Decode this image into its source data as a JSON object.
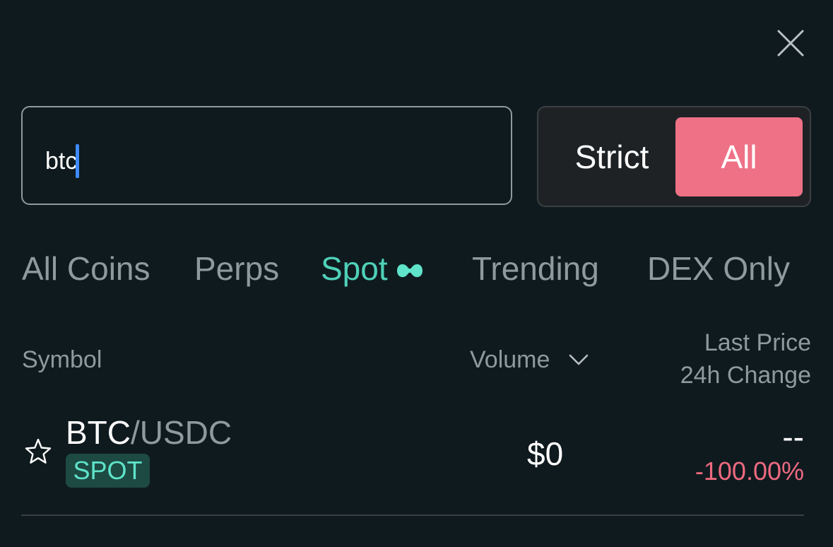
{
  "search": {
    "value": "btc"
  },
  "match_mode": {
    "options": [
      "Strict",
      "All"
    ],
    "selected": "All"
  },
  "tabs": [
    {
      "label": "All Coins",
      "active": false
    },
    {
      "label": "Perps",
      "active": false
    },
    {
      "label": "Spot",
      "active": true,
      "icon": "hyperliquid-logo-icon"
    },
    {
      "label": "Trending",
      "active": false
    },
    {
      "label": "DEX Only",
      "active": false
    }
  ],
  "table": {
    "columns": {
      "symbol": "Symbol",
      "volume": "Volume",
      "price_line1": "Last Price",
      "price_line2": "24h Change"
    },
    "rows": [
      {
        "base": "BTC",
        "quote": "/USDC",
        "badge": "SPOT",
        "volume": "$0",
        "last_price": "--",
        "change": "-100.00%"
      }
    ]
  },
  "colors": {
    "background": "#0f1a1f",
    "accent_teal": "#4fd1b8",
    "accent_pink": "#ee7186",
    "negative": "#ee6a80",
    "muted_text": "#8e9a9e"
  }
}
